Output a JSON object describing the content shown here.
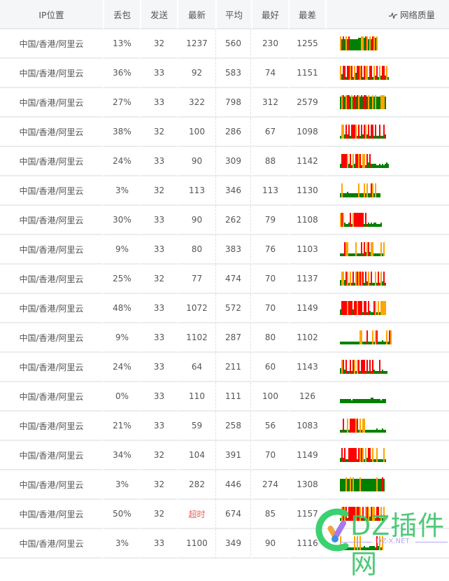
{
  "header": {
    "ip_location": "IP位置",
    "loss": "丢包",
    "sent": "发送",
    "latest": "最新",
    "average": "平均",
    "best": "最好",
    "worst": "最差",
    "quality": "网络质量",
    "quality_icon": "pulse-icon"
  },
  "colors": {
    "green": "#008000",
    "orange": "#ffa500",
    "red": "#ff0000",
    "timeout": "#f25a52"
  },
  "rows": [
    {
      "ip": "中国/香港/阿里云",
      "loss": "13%",
      "sent": "32",
      "latest": "1237",
      "avg": "560",
      "best": "230",
      "worst": "1255",
      "spark": "O8R8O8R88888899OO9RO8O8RO9O"
    },
    {
      "ip": "中国/香港/阿里云",
      "loss": "36%",
      "sent": "33",
      "latest": "92",
      "avg": "583",
      "best": "74",
      "worst": "1151",
      "spark": "O4RR2RROR2O5RROR2ROO2RR2O3R2O3RR3O2"
    },
    {
      "ip": "中国/香港/阿里云",
      "loss": "27%",
      "sent": "33",
      "latest": "322",
      "avg": "798",
      "best": "312",
      "worst": "2579",
      "spark": "9OR9ORR9O9R9RO9R9RR9O99O9O999OOO9"
    },
    {
      "ip": "中国/香港/阿里云",
      "loss": "38%",
      "sent": "32",
      "latest": "100",
      "avg": "286",
      "best": "67",
      "worst": "1098",
      "spark": "2OO3R3R2RRRO2R2R3RO3R2RR2R22R22R3"
    },
    {
      "ip": "中国/香港/阿里云",
      "loss": "24%",
      "sent": "33",
      "latest": "90",
      "avg": "309",
      "best": "88",
      "worst": "1142",
      "spark": "3RRRRO3R2O3RROR2OO2R4R3333223232343"
    },
    {
      "ip": "中国/香港/阿里云",
      "loss": "3%",
      "sent": "32",
      "latest": "113",
      "avg": "346",
      "best": "113",
      "worst": "1130",
      "spark": "3O33343333333O333O3O33RO3O333"
    },
    {
      "ip": "中国/香港/阿里云",
      "loss": "30%",
      "sent": "33",
      "latest": "90",
      "avg": "262",
      "best": "79",
      "worst": "1108",
      "spark": "ORO3223R2ORRRRRRR2R23232332223"
    },
    {
      "ip": "中国/香港/阿里云",
      "loss": "9%",
      "sent": "33",
      "latest": "80",
      "avg": "383",
      "best": "76",
      "worst": "1103",
      "spark": "222R OO22222O222R2R3OR3OO22222O2O"
    },
    {
      "ip": "中国/香港/阿里云",
      "loss": "25%",
      "sent": "32",
      "latest": "77",
      "avg": "474",
      "best": "70",
      "worst": "1137",
      "spark": "4OO4RO2O2R2OROROR2R3O2R22O2R2O3R2"
    },
    {
      "ip": "中国/香港/阿里云",
      "loss": "48%",
      "sent": "33",
      "latest": "1072",
      "avg": "572",
      "best": "70",
      "worst": "1149",
      "spark": "4RRRRORRR4RRORRR2RR2R322RO2O2OOOO"
    },
    {
      "ip": "中国/香港/阿里云",
      "loss": "9%",
      "sent": "33",
      "latest": "1102",
      "avg": "287",
      "best": "80",
      "worst": "1102",
      "spark": "22222222222222OO222R222O2OR222322O2RO"
    },
    {
      "ip": "中国/香港/阿里云",
      "loss": "24%",
      "sent": "33",
      "latest": "64",
      "avg": "211",
      "best": "60",
      "worst": "1143",
      "spark": "4OR3R22R2RO2OR2RRR2R2R2R3222R23222"
    },
    {
      "ip": "中国/香港/阿里云",
      "loss": "0%",
      "sent": "33",
      "latest": "110",
      "avg": "111",
      "best": "100",
      "worst": "126",
      "spark": "333333332333333333333344333332333"
    },
    {
      "ip": "中国/香港/阿里云",
      "loss": "21%",
      "sent": "33",
      "latest": "59",
      "avg": "258",
      "best": "56",
      "worst": "1083",
      "spark": "22R22O2RRRROR2O2OO222222223222322"
    },
    {
      "ip": "中国/香港/阿里云",
      "loss": "34%",
      "sent": "32",
      "latest": "104",
      "avg": "391",
      "best": "70",
      "worst": "1149",
      "spark": "3R3R22RRRRRR2RORO2O3RR2O22O2222O2"
    },
    {
      "ip": "中国/香港/阿里云",
      "loss": "3%",
      "sent": "32",
      "latest": "282",
      "avg": "446",
      "best": "274",
      "worst": "1308",
      "spark": "9999O99O9O9999O99999999999O999R9"
    },
    {
      "ip": "中国/香港/阿里云",
      "loss": "50%",
      "sent": "32",
      "latest": "超时",
      "latest_timeout": true,
      "avg": "674",
      "best": "85",
      "worst": "1157",
      "spark": "2OROR2RRRRRORRO2R2ORO3ROO2RR2O2O"
    },
    {
      "ip": "中国/香港/阿里云",
      "loss": "3%",
      "sent": "33",
      "latest": "1100",
      "avg": "349",
      "best": "90",
      "worst": "1116",
      "spark": "O222222222O2O2O22322233332R3O2O"
    }
  ],
  "watermark": {
    "title": "DZ插件网",
    "subtitle": "DZ-X.NET"
  }
}
